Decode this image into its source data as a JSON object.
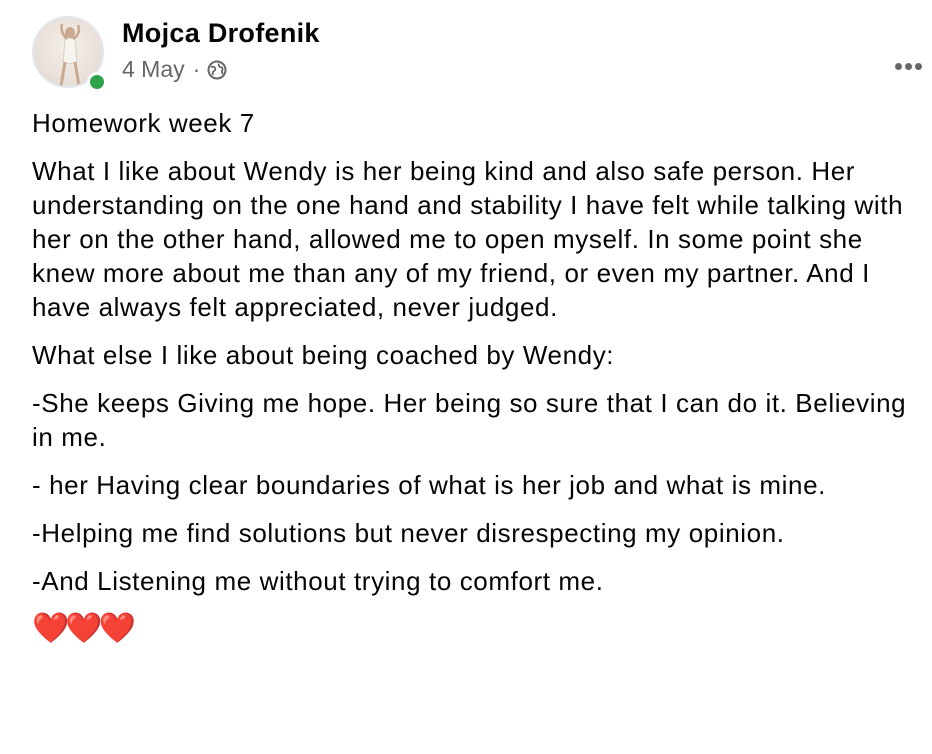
{
  "post": {
    "author": "Mojca Drofenik",
    "date": "4 May",
    "separator": "·",
    "audience_icon": "globe-icon",
    "more_icon": "more-options-icon",
    "online_color": "#31a24c",
    "paragraphs": [
      "Homework week 7",
      "What I like about Wendy is her being kind and also safe person. Her understanding on the one hand and stability I have felt while talking with her on the other hand, allowed me to open myself. In some point she knew more about me than any of my friend, or even my partner. And I have always felt appreciated, never judged.",
      "What else I like about being coached by Wendy:",
      "-She keeps Giving me hope. Her being so sure that I can do it. Believing in me.",
      "- her Having clear boundaries of what is her job and what is mine.",
      "-Helping me find solutions but never disrespecting my opinion.",
      "-And Listening me without trying to comfort me."
    ],
    "emoji": "❤️❤️❤️"
  }
}
